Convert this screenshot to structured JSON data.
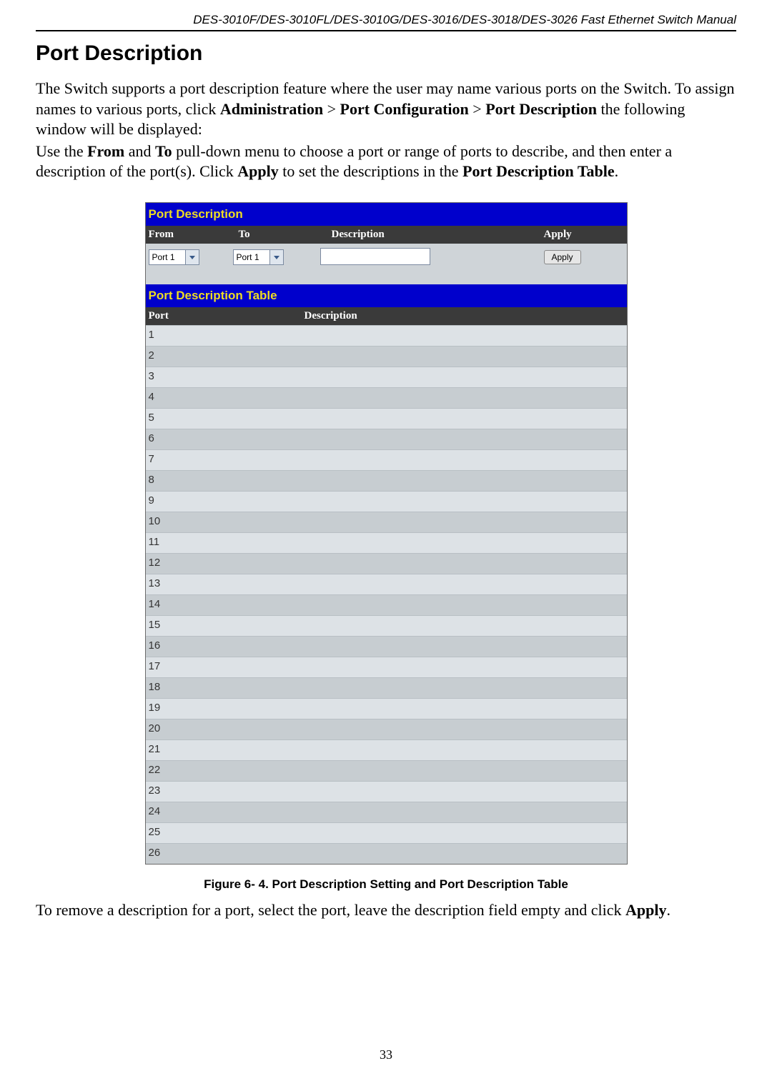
{
  "doc": {
    "header": "DES-3010F/DES-3010FL/DES-3010G/DES-3016/DES-3018/DES-3026 Fast Ethernet Switch Manual",
    "section_title": "Port Description",
    "page_number": "33",
    "para1": {
      "prefix": "The Switch supports a port description feature where the user may name various ports on the Switch. To assign names to various ports, click ",
      "b1": "Administration",
      "gt1": " > ",
      "b2": "Port Configuration",
      "gt2": " > ",
      "b3": "Port Description",
      "suffix": " the following window will be displayed:"
    },
    "para2": {
      "t1": "Use the ",
      "b1": "From",
      "t2": " and ",
      "b2": "To",
      "t3": " pull-down menu to choose a port or range of ports to describe, and then enter a description of the port(s). Click ",
      "b3": "Apply",
      "t4": " to set the descriptions in the ",
      "b4": "Port Description Table",
      "t5": "."
    },
    "figure_caption": "Figure 6- 4. Port Description Setting and Port Description Table",
    "para3": {
      "t1": "To remove a description for a port, select the port, leave the description field empty and click ",
      "b1": "Apply",
      "t2": "."
    }
  },
  "ui": {
    "panel1_title": "Port Description",
    "panel2_title": "Port Description Table",
    "labels": {
      "from": "From",
      "to": "To",
      "description": "Description",
      "apply_header": "Apply",
      "port": "Port"
    },
    "from_select_value": "Port 1",
    "to_select_value": "Port 1",
    "description_input_value": "",
    "apply_button_label": "Apply",
    "ports": [
      {
        "port": "1",
        "description": ""
      },
      {
        "port": "2",
        "description": ""
      },
      {
        "port": "3",
        "description": ""
      },
      {
        "port": "4",
        "description": ""
      },
      {
        "port": "5",
        "description": ""
      },
      {
        "port": "6",
        "description": ""
      },
      {
        "port": "7",
        "description": ""
      },
      {
        "port": "8",
        "description": ""
      },
      {
        "port": "9",
        "description": ""
      },
      {
        "port": "10",
        "description": ""
      },
      {
        "port": "11",
        "description": ""
      },
      {
        "port": "12",
        "description": ""
      },
      {
        "port": "13",
        "description": ""
      },
      {
        "port": "14",
        "description": ""
      },
      {
        "port": "15",
        "description": ""
      },
      {
        "port": "16",
        "description": ""
      },
      {
        "port": "17",
        "description": ""
      },
      {
        "port": "18",
        "description": ""
      },
      {
        "port": "19",
        "description": ""
      },
      {
        "port": "20",
        "description": ""
      },
      {
        "port": "21",
        "description": ""
      },
      {
        "port": "22",
        "description": ""
      },
      {
        "port": "23",
        "description": ""
      },
      {
        "port": "24",
        "description": ""
      },
      {
        "port": "25",
        "description": ""
      },
      {
        "port": "26",
        "description": ""
      }
    ]
  }
}
